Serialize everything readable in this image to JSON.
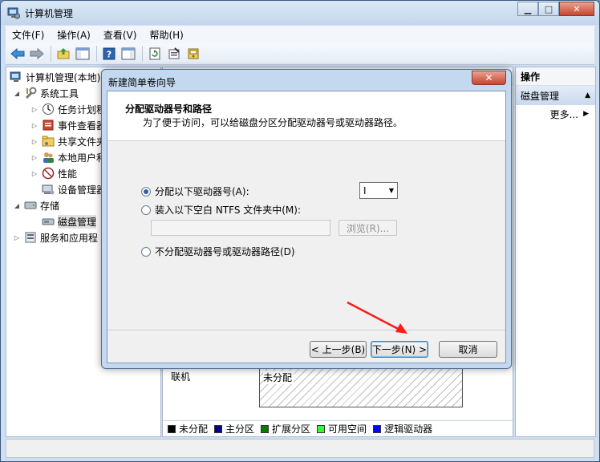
{
  "window": {
    "title": "计算机管理",
    "minimize": "▁",
    "maximize": "□",
    "close": "✕"
  },
  "menu": {
    "items": [
      "文件(F)",
      "操作(A)",
      "查看(V)",
      "帮助(H)"
    ]
  },
  "tree": {
    "root": "计算机管理(本地)",
    "system_tools": "系统工具",
    "task_scheduler": "任务计划程",
    "event_viewer": "事件查看器",
    "shared_folders": "共享文件夹",
    "local_users": "本地用户和",
    "performance": "性能",
    "device_manager": "设备管理器",
    "storage": "存储",
    "disk_management": "磁盘管理",
    "services": "服务和应用程"
  },
  "center": {
    "disk_status": "联机",
    "volume_label": "未分配"
  },
  "legend": [
    {
      "label": "未分配",
      "color": "#000000"
    },
    {
      "label": "主分区",
      "color": "#00008b"
    },
    {
      "label": "扩展分区",
      "color": "#008000"
    },
    {
      "label": "可用空间",
      "color": "#32ff32"
    },
    {
      "label": "逻辑驱动器",
      "color": "#0000ff"
    }
  ],
  "actions": {
    "header": "操作",
    "section": "磁盘管理",
    "more": "更多..."
  },
  "wizard": {
    "title": "新建简单卷向导",
    "close": "✕",
    "heading": "分配驱动器号和路径",
    "subheading": "为了便于访问，可以给磁盘分区分配驱动器号或驱动器路径。",
    "option_letter": "分配以下驱动器号(A):",
    "option_folder": "装入以下空白 NTFS 文件夹中(M):",
    "option_none": "不分配驱动器号或驱动器路径(D)",
    "selected_option": "letter",
    "drive_letter": "I",
    "browse": "浏览(R)...",
    "back": "< 上一步(B)",
    "next": "下一步(N) >",
    "cancel": "取消"
  }
}
